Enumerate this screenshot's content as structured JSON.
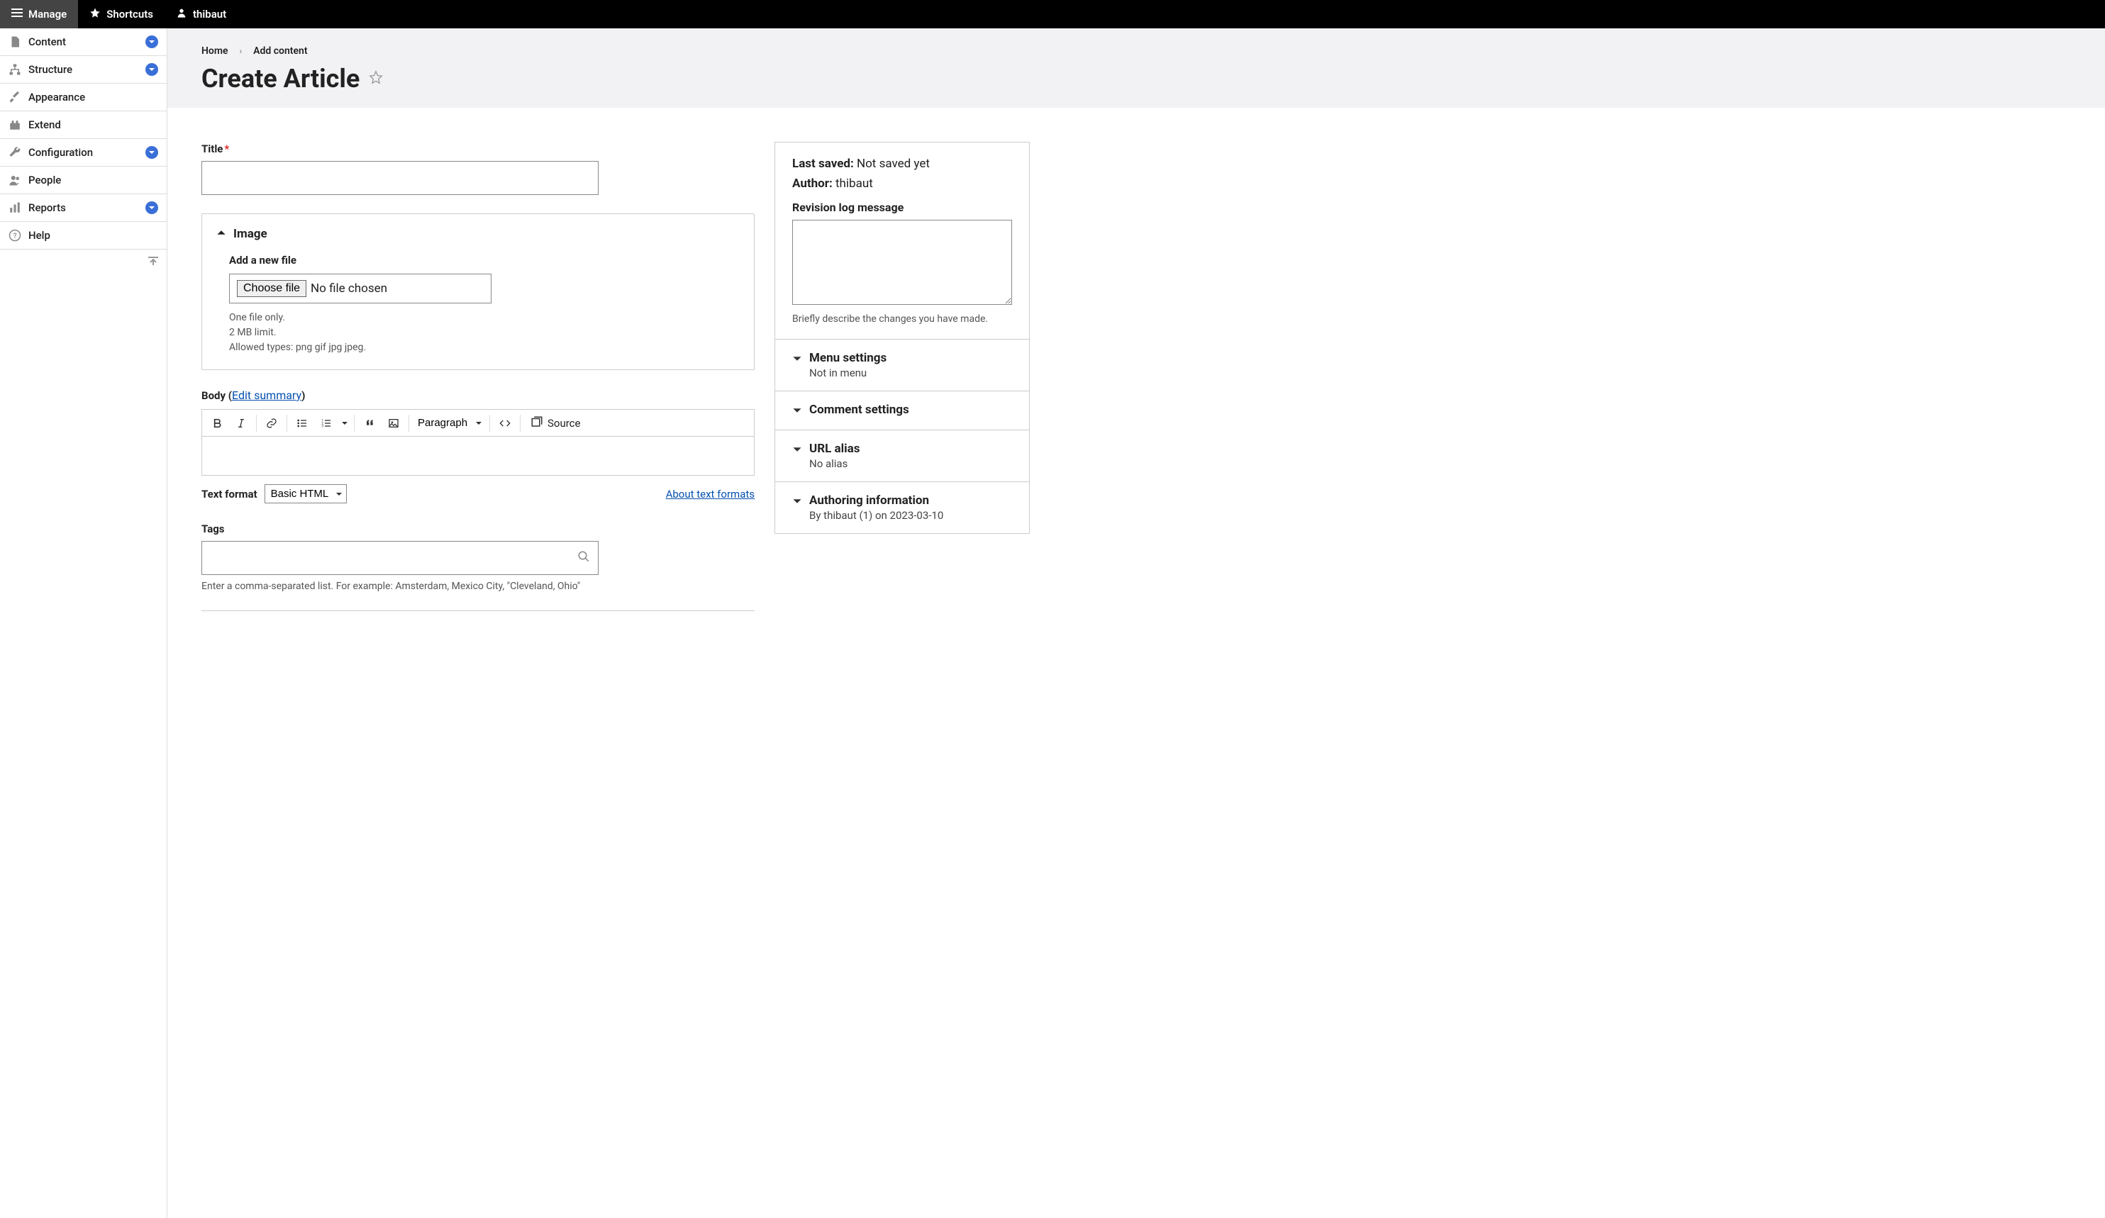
{
  "topbar": {
    "manage": "Manage",
    "shortcuts": "Shortcuts",
    "user": "thibaut"
  },
  "sidebar": {
    "items": [
      {
        "label": "Content",
        "expandable": true
      },
      {
        "label": "Structure",
        "expandable": true
      },
      {
        "label": "Appearance",
        "expandable": false
      },
      {
        "label": "Extend",
        "expandable": false
      },
      {
        "label": "Configuration",
        "expandable": true
      },
      {
        "label": "People",
        "expandable": false
      },
      {
        "label": "Reports",
        "expandable": true
      },
      {
        "label": "Help",
        "expandable": false
      }
    ]
  },
  "breadcrumb": {
    "home": "Home",
    "add_content": "Add content"
  },
  "page_title": "Create Article",
  "form": {
    "title_label": "Title",
    "title_value": "",
    "image_section": "Image",
    "add_file_label": "Add a new file",
    "choose_file_btn": "Choose file",
    "no_file_chosen": "No file chosen",
    "file_help_1": "One file only.",
    "file_help_2": "2 MB limit.",
    "file_help_3": "Allowed types: png gif jpg jpeg.",
    "body_label": "Body (",
    "edit_summary": "Edit summary",
    "body_label_close": ")",
    "toolbar": {
      "paragraph": "Paragraph",
      "source": "Source"
    },
    "text_format_label": "Text format",
    "text_format_value": "Basic HTML",
    "about_formats": "About text formats",
    "tags_label": "Tags",
    "tags_value": "",
    "tags_help": "Enter a comma-separated list. For example: Amsterdam, Mexico City, \"Cleveland, Ohio\""
  },
  "meta": {
    "last_saved_label": "Last saved:",
    "last_saved_value": "Not saved yet",
    "author_label": "Author:",
    "author_value": "thibaut",
    "revision_label": "Revision log message",
    "revision_value": "",
    "revision_help": "Briefly describe the changes you have made.",
    "accordions": [
      {
        "title": "Menu settings",
        "sub": "Not in menu"
      },
      {
        "title": "Comment settings",
        "sub": ""
      },
      {
        "title": "URL alias",
        "sub": "No alias"
      },
      {
        "title": "Authoring information",
        "sub": "By thibaut (1) on 2023-03-10"
      }
    ]
  }
}
